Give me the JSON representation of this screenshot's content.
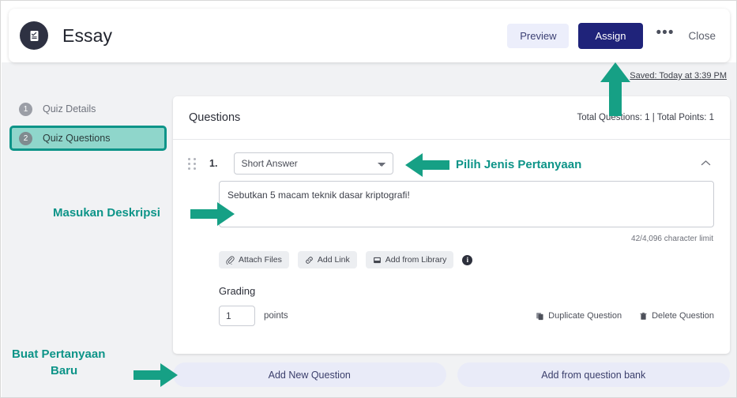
{
  "header": {
    "icon": "quiz-icon",
    "title": "Essay",
    "preview_label": "Preview",
    "assign_label": "Assign",
    "more_label": "•••",
    "close_label": "Close",
    "saved_text": "Saved: Today at 3:39 PM",
    "assign_bg": "#1f237a",
    "preview_bg": "#eceefb"
  },
  "sidebar": {
    "items": [
      {
        "num": "1",
        "label": "Quiz Details",
        "active": false
      },
      {
        "num": "2",
        "label": "Quiz Questions",
        "active": true
      }
    ],
    "active_highlight_color": "#0d9488"
  },
  "questions_panel": {
    "title": "Questions",
    "meta": "Total Questions: 1  |  Total Points: 1",
    "question": {
      "index": "1.",
      "drag_handle_icon": "drag-handle-icon",
      "type_value": "Short Answer",
      "type_options": [
        "Short Answer"
      ],
      "collapse_icon": "chevron-up-icon",
      "description_value": "Sebutkan 5 macam teknik dasar kriptografi!",
      "description_placeholder": "",
      "char_limit": "42/4,096 character limit",
      "attachments": [
        {
          "icon": "paperclip-icon",
          "label": "Attach Files"
        },
        {
          "icon": "link-icon",
          "label": "Add Link"
        },
        {
          "icon": "library-image-icon",
          "label": "Add from Library"
        }
      ],
      "info_icon": "info-icon",
      "info_glyph": "i",
      "grading_title": "Grading",
      "points_value": "1",
      "points_label": "points",
      "actions": [
        {
          "icon": "duplicate-icon",
          "label": "Duplicate Question"
        },
        {
          "icon": "trash-icon",
          "label": "Delete Question"
        }
      ]
    }
  },
  "footer": {
    "add_new_question": "Add New Question",
    "add_from_bank": "Add from question bank"
  },
  "annotations": {
    "color": "#0d9488",
    "question_type": "Pilih Jenis Pertanyaan",
    "description": "Masukan Deskripsi",
    "new_question_line1": "Buat Pertanyaan",
    "new_question_line2": "Baru"
  }
}
